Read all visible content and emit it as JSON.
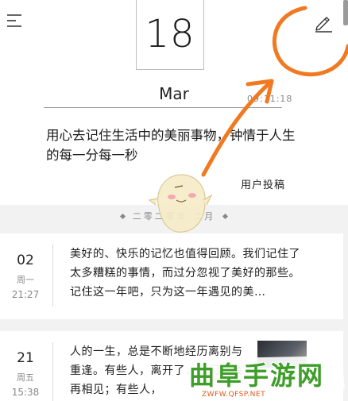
{
  "header": {
    "day": "18",
    "month": "Mar",
    "time": "09:11:18",
    "icons": {
      "menu": "menu-icon",
      "edit": "pencil-icon"
    }
  },
  "featured": {
    "quote": "用心去记住生活中的美丽事物，钟情于人生的每一分每一秒",
    "author": "用户投稿"
  },
  "section": {
    "label": "二零二零年 二月"
  },
  "entries": [
    {
      "day": "02",
      "weekday": "周一",
      "time": "21:27",
      "text": "美好的、快乐的记忆也值得回顾。我们记住了太多糟糕的事情，而过分忽视了美好的那些。记住这一年吧，只为这一年遇见的美…"
    },
    {
      "day": "21",
      "weekday": "周五",
      "time": "15:38",
      "text": "人的一生，总是不断地经历离别与重逢。有些人，离开了，我们还会再相见；有些人，"
    }
  ],
  "watermark": {
    "name": "曲阜手游网",
    "url": "ZWFW.QFSP.NET"
  },
  "colors": {
    "annotation": "#f07a22",
    "watermark_green": "#3f9e2a",
    "watermark_url": "#e05a1c"
  }
}
